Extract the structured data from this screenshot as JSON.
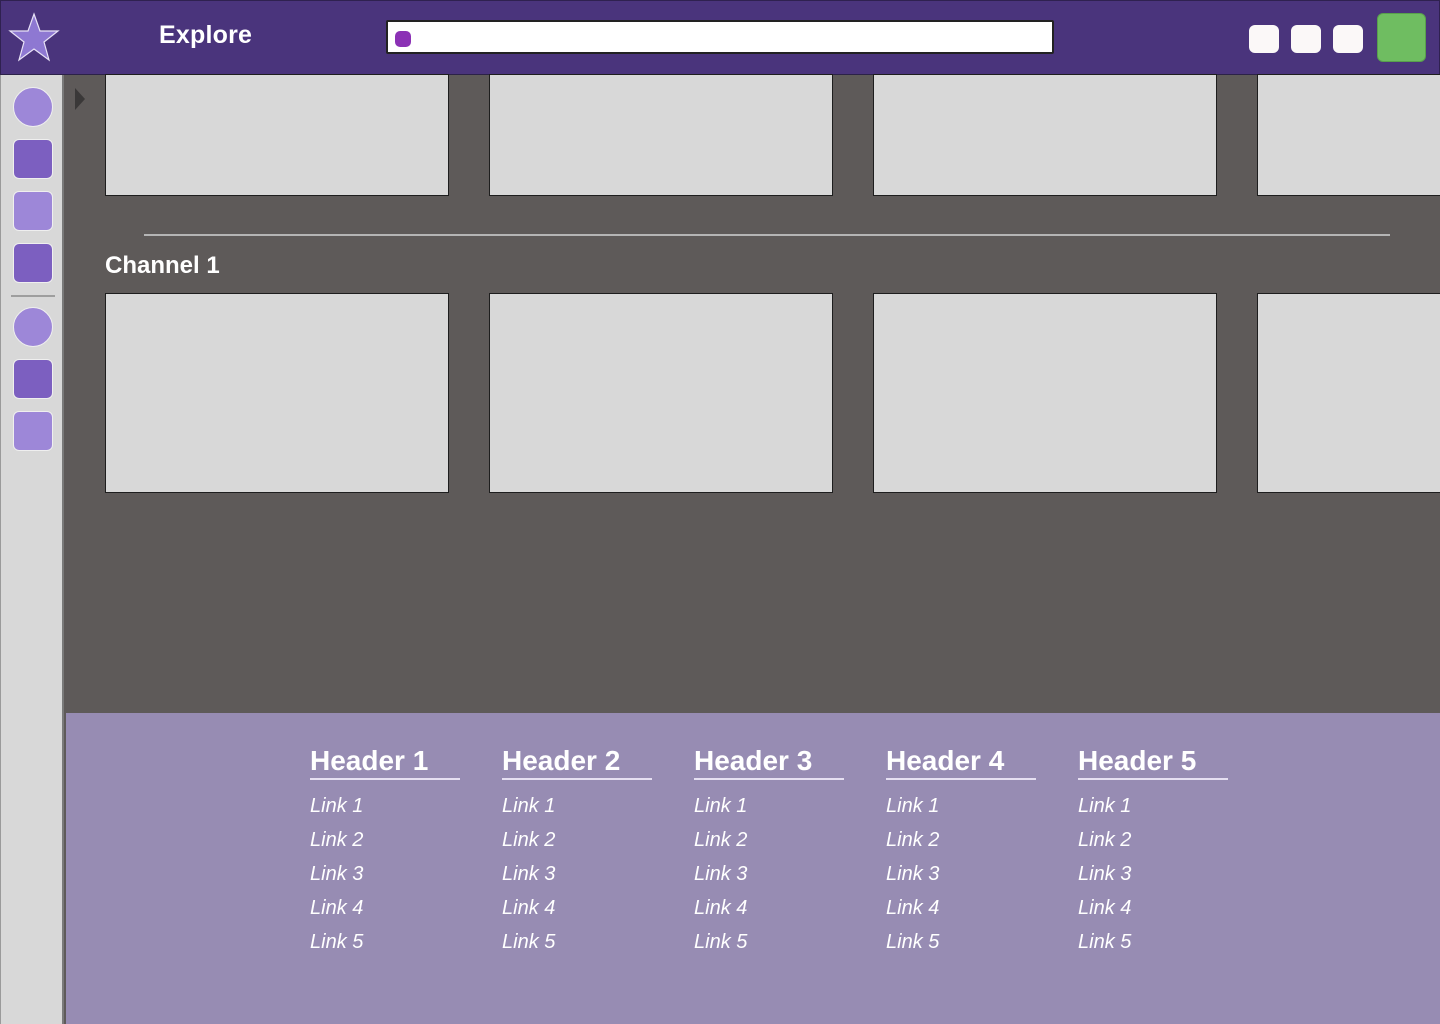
{
  "header": {
    "title": "Explore",
    "search_placeholder": "",
    "colors": {
      "bar": "#4a347c",
      "accent": "#8b31b5",
      "profile": "#6fbd61"
    },
    "icons": [
      "star-icon",
      "search-dot-icon"
    ]
  },
  "sidebar": {
    "items": [
      {
        "name": "sidebar-item-1",
        "shape": "circle"
      },
      {
        "name": "sidebar-item-2",
        "shape": "square-dark"
      },
      {
        "name": "sidebar-item-3",
        "shape": "square-light"
      },
      {
        "name": "sidebar-item-4",
        "shape": "square-dark"
      },
      {
        "name": "sidebar-item-5",
        "shape": "circle"
      },
      {
        "name": "sidebar-item-6",
        "shape": "square-dark"
      },
      {
        "name": "sidebar-item-7",
        "shape": "square-light"
      }
    ]
  },
  "main": {
    "channel_title": "Channel 1"
  },
  "footer": {
    "columns": [
      {
        "header": "Header 1",
        "links": [
          "Link 1",
          "Link 2",
          "Link 3",
          "Link 4",
          "Link 5"
        ]
      },
      {
        "header": "Header 2",
        "links": [
          "Link 1",
          "Link 2",
          "Link 3",
          "Link 4",
          "Link 5"
        ]
      },
      {
        "header": "Header 3",
        "links": [
          "Link 1",
          "Link 2",
          "Link 3",
          "Link 4",
          "Link 5"
        ]
      },
      {
        "header": "Header 4",
        "links": [
          "Link 1",
          "Link 2",
          "Link 3",
          "Link 4",
          "Link 5"
        ]
      },
      {
        "header": "Header 5",
        "links": [
          "Link 1",
          "Link 2",
          "Link 3",
          "Link 4",
          "Link 5"
        ]
      }
    ]
  }
}
